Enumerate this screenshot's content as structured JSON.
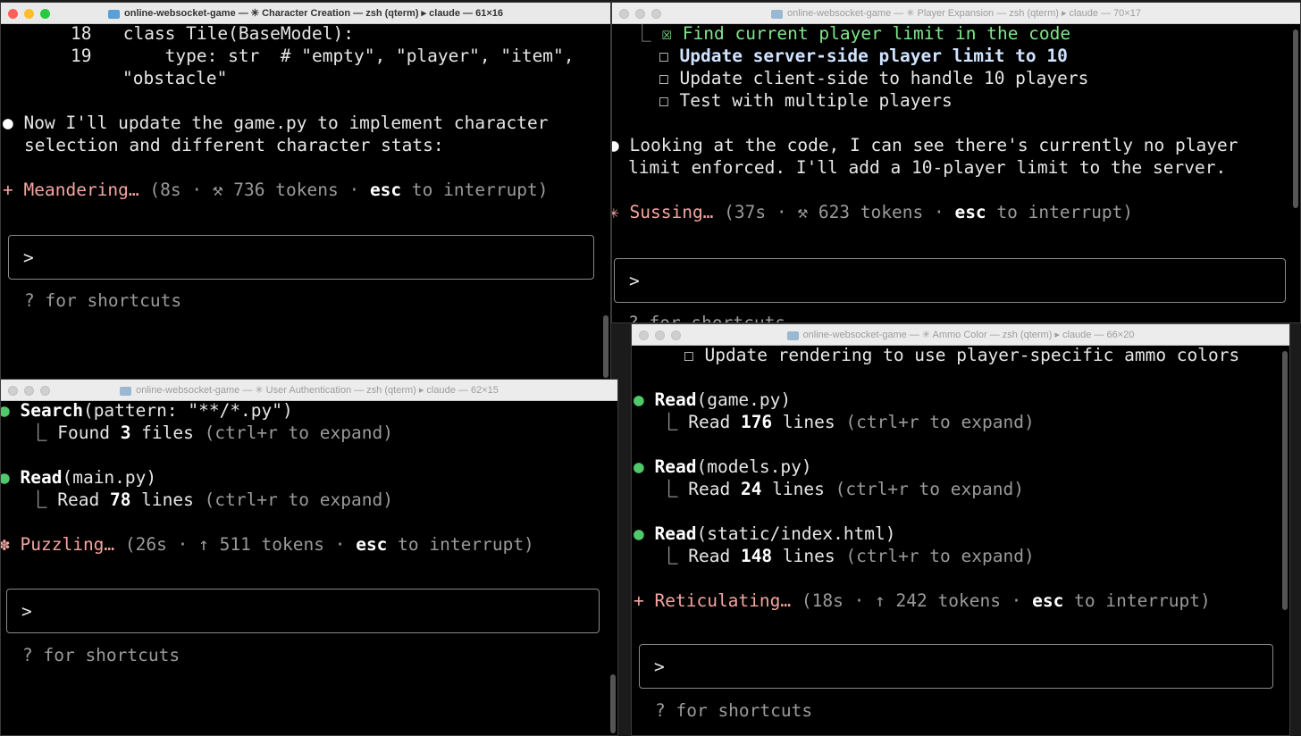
{
  "win1": {
    "title": "online-websocket-game — ✳ Character Creation — zsh (qterm) ▸ claude — 61×16",
    "code_line_18_num": "18",
    "code_line_18": "class Tile(BaseModel):",
    "code_line_19_num": "19",
    "code_line_19": "type: str  # \"empty\", \"player\", \"item\",",
    "code_line_19b": "\"obstacle\"",
    "bullet": "●",
    "message_1": "Now I'll update the game.py to implement character",
    "message_2": "selection and different character stats:",
    "status_icon": "+",
    "status_word": "Meandering…",
    "status_open": "(8s · ⚒ 736 tokens · ",
    "status_esc": "esc",
    "status_close": " to interrupt)",
    "prompt": ">",
    "shortcuts": "? for shortcuts"
  },
  "win2": {
    "title": "online-websocket-game — ✳ Player Expansion — zsh (qterm) ▸ claude — 70×17",
    "todo_prefix": "⎿ ",
    "todo_check": "☒",
    "todo_box": "☐",
    "todo_1": "Find current player limit in the code",
    "todo_2": "Update server-side player limit to 10",
    "todo_3": "Update client-side to handle 10 players",
    "todo_4": "Test with multiple players",
    "bullet": "●",
    "message_1": "Looking at the code, I can see there's currently no player",
    "message_2": "limit enforced. I'll add a 10-player limit to the server.",
    "status_icon": "✳",
    "status_word": "Sussing…",
    "status_open": "(37s · ⚒ 623 tokens · ",
    "status_esc": "esc",
    "status_close": " to interrupt)",
    "prompt": ">",
    "shortcuts": "? for shortcuts"
  },
  "win3": {
    "title": "online-websocket-game — ✳ User Authentication — zsh (qterm) ▸ claude — 62×15",
    "bullet": "●",
    "tool_1_name": "Search",
    "tool_1_args": "(pattern: \"**/*.py\")",
    "tool_1_result_pre": "⎿ Found ",
    "tool_1_result_num": "3",
    "tool_1_result_post": " files ",
    "tool_1_expand": "(ctrl+r to expand)",
    "tool_2_name": "Read",
    "tool_2_args": "(main.py)",
    "tool_2_result_pre": "⎿ Read ",
    "tool_2_result_num": "78",
    "tool_2_result_post": " lines ",
    "tool_2_expand": "(ctrl+r to expand)",
    "status_icon": "✽",
    "status_word": "Puzzling…",
    "status_open": "(26s · ↑ 511 tokens · ",
    "status_esc": "esc",
    "status_close": " to interrupt)",
    "prompt": ">",
    "shortcuts": "? for shortcuts"
  },
  "win4": {
    "title": "online-websocket-game — ✳ Ammo Color — zsh (qterm) ▸ claude — 66×20",
    "todo_box": "☐",
    "todo_1": "Update rendering to use player-specific ammo colors",
    "bullet": "●",
    "tool_1_name": "Read",
    "tool_1_args": "(game.py)",
    "tool_1_result_pre": "⎿ Read ",
    "tool_1_result_num": "176",
    "tool_1_result_post": " lines ",
    "tool_1_expand": "(ctrl+r to expand)",
    "tool_2_name": "Read",
    "tool_2_args": "(models.py)",
    "tool_2_result_pre": "⎿ Read ",
    "tool_2_result_num": "24",
    "tool_2_result_post": " lines ",
    "tool_2_expand": "(ctrl+r to expand)",
    "tool_3_name": "Read",
    "tool_3_args": "(static/index.html)",
    "tool_3_result_pre": "⎿ Read ",
    "tool_3_result_num": "148",
    "tool_3_result_post": " lines ",
    "tool_3_expand": "(ctrl+r to expand)",
    "status_icon": "+",
    "status_word": "Reticulating…",
    "status_open": "(18s · ↑ 242 tokens · ",
    "status_esc": "esc",
    "status_close": " to interrupt)",
    "prompt": ">",
    "shortcuts": "? for shortcuts"
  },
  "colors": {
    "close": "#ff5f57",
    "minimize": "#febc2e",
    "zoom": "#28c840",
    "bullet_green": "#4fc96b",
    "status_salmon": "#f4a6a0",
    "todo_done_green": "#7ee787"
  }
}
